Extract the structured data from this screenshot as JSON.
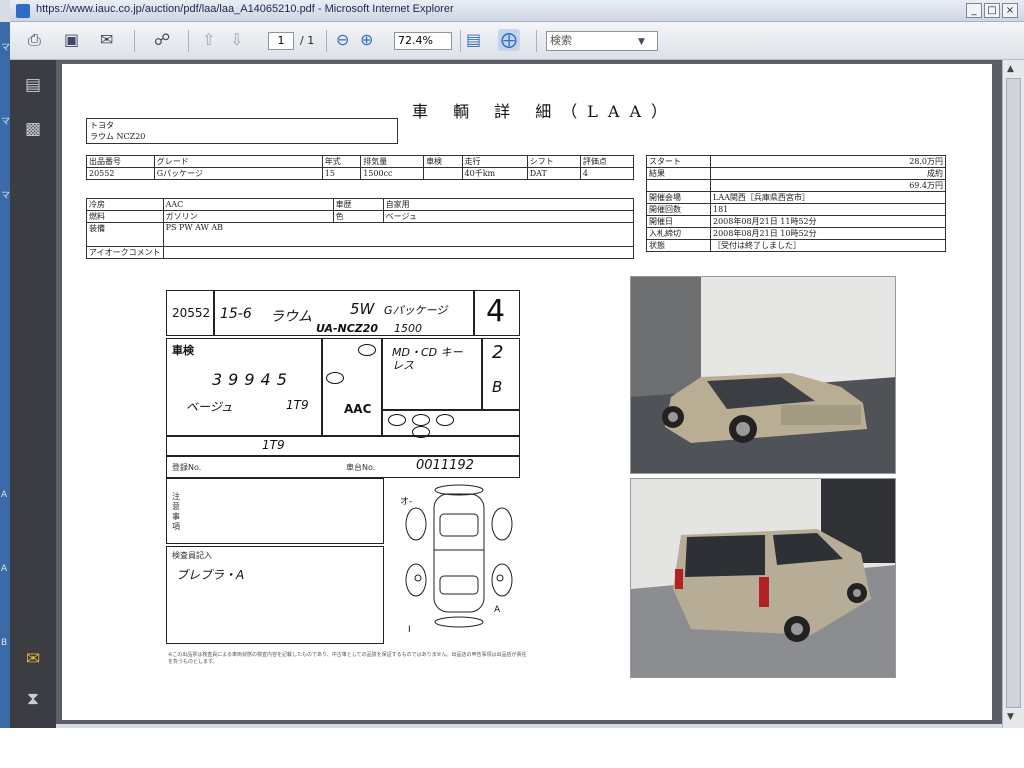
{
  "window": {
    "title": "https://www.iauc.co.jp/auction/pdf/laa/laa_A14065210.pdf - Microsoft Internet Explorer",
    "buttons": [
      "_",
      "□",
      "×"
    ]
  },
  "toolbar": {
    "page_current": "1",
    "page_total": "/ 1",
    "zoom": "72.4%",
    "search_placeholder": "検索",
    "icons": [
      "print-icon",
      "save-icon",
      "email-icon",
      "globe-icon",
      "prev-page-icon",
      "next-page-icon",
      "zoom-out-icon",
      "zoom-in-icon",
      "fit-width-icon",
      "fit-page-icon"
    ]
  },
  "left_strip_chars": [
    "マ",
    "マ",
    "マ",
    "A",
    "A",
    "B"
  ],
  "document": {
    "title": "車 輌 詳 細（LAA）",
    "maker": "トヨタ",
    "model_line": "ラウム NCZ20",
    "spec_headers": [
      "出品番号",
      "グレード",
      "年式",
      "排気量",
      "車検",
      "走行",
      "シフト",
      "評価点"
    ],
    "spec_values": [
      "20552",
      "Gパッケージ",
      "15",
      "1500cc",
      "",
      "40千km",
      "DAT",
      "4"
    ],
    "detail_rows": [
      {
        "k1": "冷房",
        "v1": "AAC",
        "k2": "車歴",
        "v2": "自家用"
      },
      {
        "k1": "燃料",
        "v1": "ガソリン",
        "k2": "色",
        "v2": "ベージュ"
      },
      {
        "k1": "装備",
        "v1": "PS PW AW AB",
        "k2": "",
        "v2": ""
      },
      {
        "k1": "アイオークコメント",
        "v1": "",
        "k2": "",
        "v2": ""
      }
    ],
    "result_rows": [
      {
        "k": "スタート",
        "v": "28.0万円"
      },
      {
        "k": "結果",
        "v": "成約"
      },
      {
        "k": "",
        "v": "69.4万円"
      },
      {
        "k": "開催会場",
        "v": "LAA関西［兵庫県西宮市］"
      },
      {
        "k": "開催回数",
        "v": "181"
      },
      {
        "k": "開催日",
        "v": "2008年08月21日 11時52分"
      },
      {
        "k": "入札締切",
        "v": "2008年08月21日 10時52分"
      },
      {
        "k": "状態",
        "v": "［受付は終了しました］"
      }
    ],
    "sheet": {
      "lot": "20552",
      "year": "15-6",
      "name": "ラウム",
      "body": "5W",
      "grade": "Gパッケージ",
      "model_code": "UA-NCZ20",
      "cc": "1500",
      "score": "4",
      "shaken": "車検",
      "mileage": "39945",
      "color": "ベージュ",
      "color_no": "1T9",
      "ac": "AAC",
      "inspector_note": "MD・CD キーレス",
      "chassis_no": "0011192",
      "reg_label": "登録No.",
      "chassis_label": "車台No.",
      "notes_label": "注意事項",
      "inspector_label": "検査員記入",
      "inspector_text": "ブレブラ・A",
      "interior": "2",
      "exterior": "B",
      "footnote": "※この出品票は検査員による車両状態の検査内容を記載したものであり、中古車としての品質を保証するものではありません。出品店の申告事項は出品店が責任を負うものとします。"
    },
    "photos": [
      "front-three-quarter-photo",
      "rear-three-quarter-photo"
    ]
  }
}
